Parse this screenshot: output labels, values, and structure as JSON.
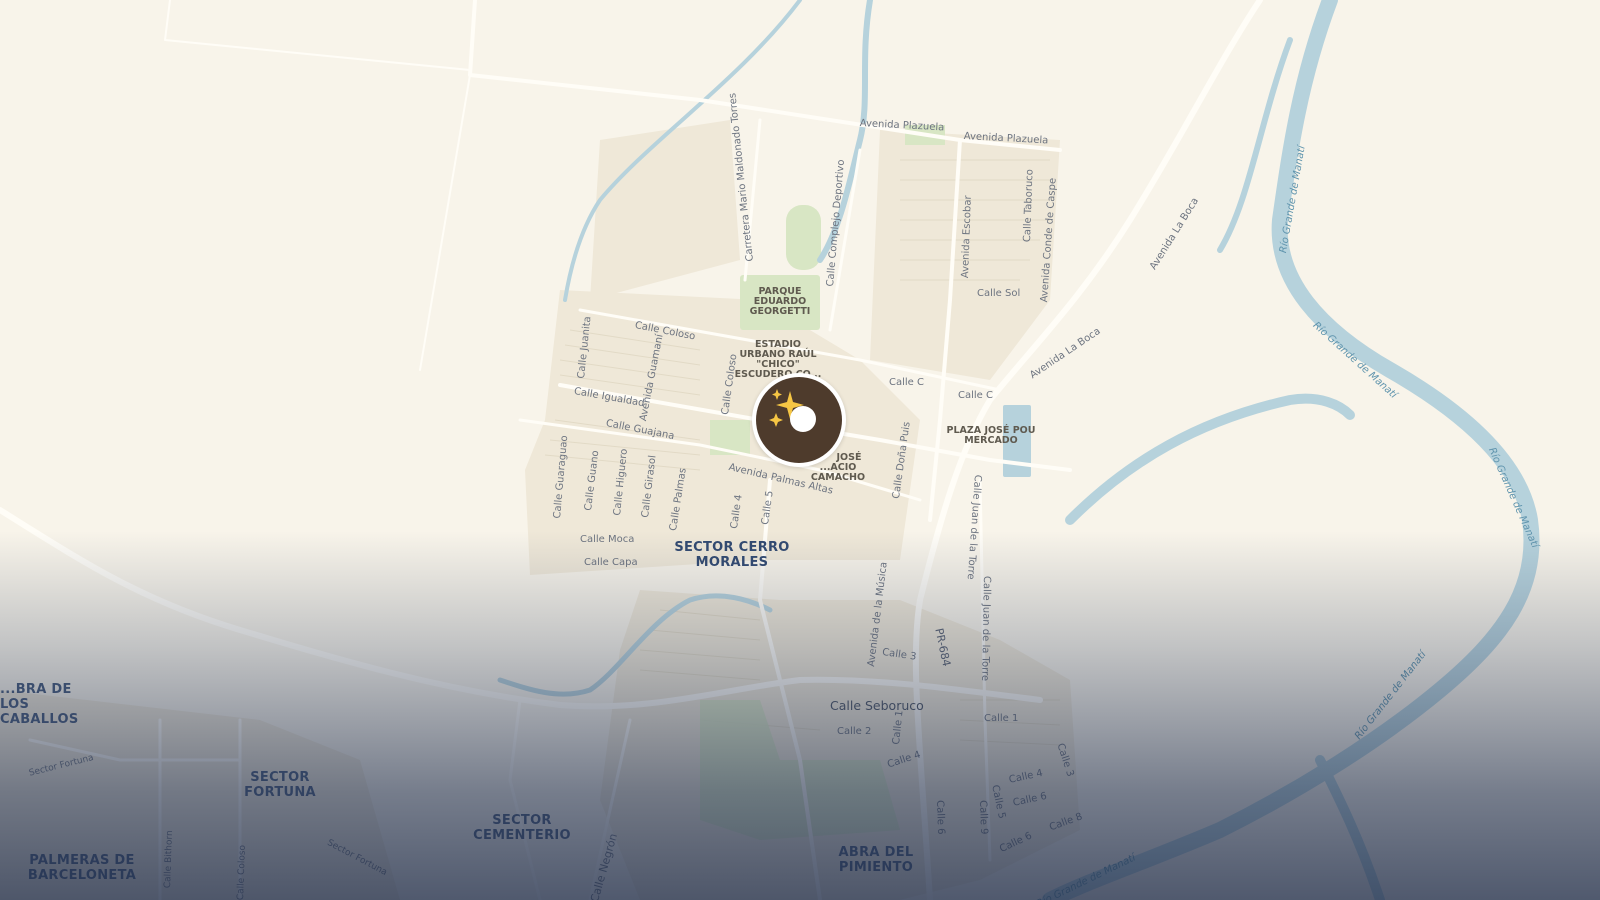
{
  "map": {
    "streets": [
      {
        "id": "avenida-plazuela-1",
        "text": "Avenida Plazuela"
      },
      {
        "id": "avenida-plazuela-2",
        "text": "Avenida Plazuela"
      },
      {
        "id": "carretera-mario-maldonado",
        "text": "Carretera Mario Maldonado Torres"
      },
      {
        "id": "calle-complejo-deportivo",
        "text": "Calle Complejo Deportivo"
      },
      {
        "id": "avenida-escobar",
        "text": "Avenida Escobar"
      },
      {
        "id": "calle-taboruco",
        "text": "Calle Taboruco"
      },
      {
        "id": "avenida-conde-de-caspe",
        "text": "Avenida Conde de Caspe"
      },
      {
        "id": "calle-sol",
        "text": "Calle Sol"
      },
      {
        "id": "avenida-la-boca-1",
        "text": "Avenida La Boca"
      },
      {
        "id": "avenida-la-boca-2",
        "text": "Avenida La Boca"
      },
      {
        "id": "calle-coloso-1",
        "text": "Calle Coloso"
      },
      {
        "id": "calle-coloso-2",
        "text": "Calle Coloso"
      },
      {
        "id": "calle-juanita",
        "text": "Calle Juanita"
      },
      {
        "id": "avenida-guamani",
        "text": "Avenida Guamaní"
      },
      {
        "id": "calle-igualdad",
        "text": "Calle Igualdad"
      },
      {
        "id": "calle-guajana",
        "text": "Calle Guajana"
      },
      {
        "id": "calle-c-1",
        "text": "Calle C"
      },
      {
        "id": "calle-c-2",
        "text": "Calle C"
      },
      {
        "id": "calle-guaraguao",
        "text": "Calle Guaraguao"
      },
      {
        "id": "calle-guano",
        "text": "Calle Guano"
      },
      {
        "id": "calle-higuero",
        "text": "Calle Higuero"
      },
      {
        "id": "calle-girasol",
        "text": "Calle Girasol"
      },
      {
        "id": "calle-palmas",
        "text": "Calle Palmas"
      },
      {
        "id": "calle-4",
        "text": "Calle 4"
      },
      {
        "id": "calle-5",
        "text": "Calle 5"
      },
      {
        "id": "avenida-palmas-altas",
        "text": "Avenida Palmas Altas"
      },
      {
        "id": "calle-dona-puis",
        "text": "Calle Doña Puis"
      },
      {
        "id": "calle-juan-de-la-torre-1",
        "text": "Calle Juan de la Torre"
      },
      {
        "id": "calle-juan-de-la-torre-2",
        "text": "Calle Juan de la Torre"
      },
      {
        "id": "calle-moca",
        "text": "Calle Moca"
      },
      {
        "id": "calle-capa",
        "text": "Calle Capa"
      },
      {
        "id": "avenida-de-la-musica",
        "text": "Avenida de la Música"
      },
      {
        "id": "calle-3-a",
        "text": "Calle 3"
      },
      {
        "id": "pr-684",
        "text": "PR-684"
      },
      {
        "id": "calle-seboruco",
        "text": "Calle Seboruco"
      },
      {
        "id": "calle-1-a",
        "text": "Calle 1"
      },
      {
        "id": "calle-1-b",
        "text": "Calle 1"
      },
      {
        "id": "calle-2",
        "text": "Calle 2"
      },
      {
        "id": "calle-4-b",
        "text": "Calle 4"
      },
      {
        "id": "calle-4-c",
        "text": "Calle 4"
      },
      {
        "id": "calle-3-b",
        "text": "Calle 3"
      },
      {
        "id": "calle-5-b",
        "text": "Calle 5"
      },
      {
        "id": "calle-6-a",
        "text": "Calle 6"
      },
      {
        "id": "calle-6-b",
        "text": "Calle 6"
      },
      {
        "id": "calle-6-c",
        "text": "Calle 6"
      },
      {
        "id": "calle-8",
        "text": "Calle 8"
      },
      {
        "id": "calle-9",
        "text": "Calle 9"
      },
      {
        "id": "sector-fortuna-road-1",
        "text": "Sector Fortuna"
      },
      {
        "id": "sector-fortuna-road-2",
        "text": "Sector Fortuna"
      },
      {
        "id": "calle-bithorn",
        "text": "Calle Bithorn"
      },
      {
        "id": "calle-coloso-3",
        "text": "Calle Coloso"
      },
      {
        "id": "calle-negron",
        "text": "Calle Negrón"
      }
    ],
    "rivers": [
      {
        "id": "rio-grande-1",
        "text": "Río Grande de Manatí"
      },
      {
        "id": "rio-grande-2",
        "text": "Río Grande de Manatí"
      },
      {
        "id": "rio-grande-3",
        "text": "Río Grande de Manatí"
      },
      {
        "id": "rio-grande-4",
        "text": "Río Grande de Manatí"
      },
      {
        "id": "rio-grande-5",
        "text": "Río Grande de Manatí"
      }
    ],
    "pois": {
      "parque": "PARQUE EDUARDO GEORGETTI",
      "estadio": "ESTADIO URBANO RAÚL \"CHICO\" ESCUDERO CO...",
      "plaza_line1": "PLAZA JOSÉ POU",
      "plaza_line2": "MERCADO",
      "jose_line1": "JOSÉ",
      "jose_line2": "...ACIO",
      "jose_line3": "CAMACHO"
    },
    "areas": {
      "cerro_morales": "SECTOR CERRO MORALES",
      "abra_caballos": "...BRA DE LOS CABALLOS",
      "sector_fortuna": "SECTOR FORTUNA",
      "sector_cementerio": "SECTOR CEMENTERIO",
      "palmeras": "PALMERAS DE BARCELONETA",
      "abra_pimiento": "ABRA DEL PIMIENTO"
    },
    "marker": {
      "icon": "sparkles-icon",
      "color": "#4e3b2c"
    },
    "colors": {
      "land": "#f8f4ea",
      "water": "#b6d2dc",
      "park": "#d8e6c4",
      "road": "#ffffff"
    }
  }
}
